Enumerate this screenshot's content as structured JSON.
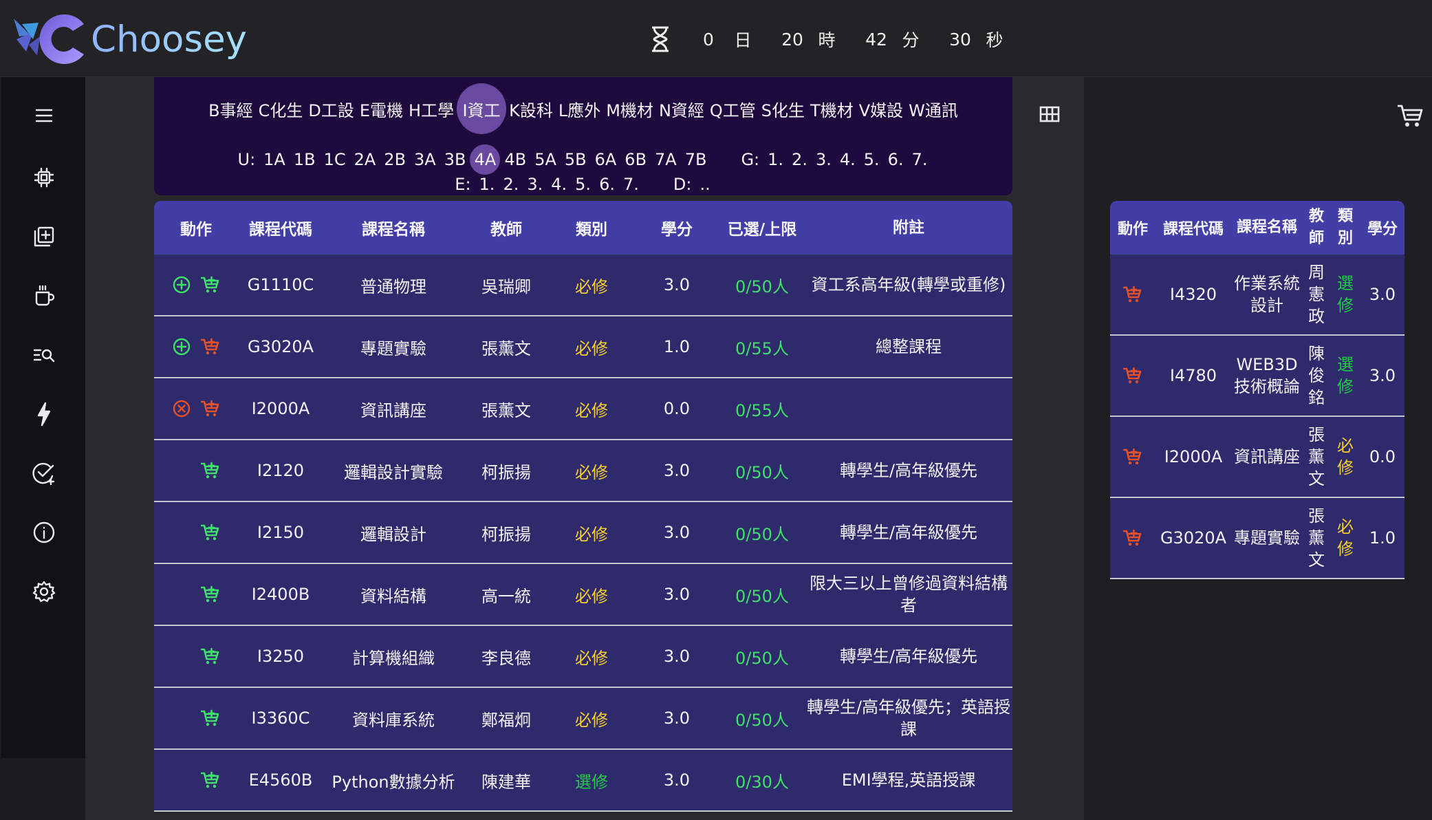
{
  "app": {
    "name": "Choosey"
  },
  "timer": {
    "days": "0",
    "days_unit": "日",
    "hours": "20",
    "hours_unit": "時",
    "minutes": "42",
    "minutes_unit": "分",
    "seconds": "30",
    "seconds_unit": "秒"
  },
  "sidebar": {
    "items": [
      {
        "icon": "menu-icon"
      },
      {
        "icon": "chip-icon"
      },
      {
        "icon": "add-box-icon"
      },
      {
        "icon": "coffee-icon"
      },
      {
        "icon": "search-list-icon"
      },
      {
        "icon": "flash-icon"
      },
      {
        "icon": "check-add-icon"
      },
      {
        "icon": "info-icon"
      },
      {
        "icon": "settings-icon"
      }
    ]
  },
  "departments": [
    "B事經",
    "C化生",
    "D工設",
    "E電機",
    "H工學",
    "I資工",
    "K設科",
    "L應外",
    "M機材",
    "N資經",
    "Q工管",
    "S化生",
    "T機材",
    "V媒設",
    "W通訊"
  ],
  "selected_department": "I資工",
  "grade_filter": {
    "u_label": "U:",
    "u_items": [
      "1A",
      "1B",
      "1C",
      "2A",
      "2B",
      "3A",
      "3B",
      "4A",
      "4B",
      "5A",
      "5B",
      "6A",
      "6B",
      "7A",
      "7B"
    ],
    "u_selected": "4A",
    "g_label": "G:",
    "g_items": [
      "1.",
      "2.",
      "3.",
      "4.",
      "5.",
      "6.",
      "7."
    ],
    "e_label": "E:",
    "e_items": [
      "1.",
      "2.",
      "3.",
      "4.",
      "5.",
      "6.",
      "7."
    ],
    "d_label": "D:",
    "d_items": [
      ".."
    ]
  },
  "course_table": {
    "headers": [
      "動作",
      "課程代碼",
      "課程名稱",
      "教師",
      "類別",
      "學分",
      "已選/上限",
      "附註"
    ],
    "rows": [
      {
        "add": "add",
        "cart": "green",
        "code": "G1110C",
        "name": "普通物理",
        "teacher": "吳瑞卿",
        "type": "必修",
        "type_kind": "req",
        "credit": "3.0",
        "enrolled": "0/50人",
        "note": "資工系高年級(轉學或重修)"
      },
      {
        "add": "add",
        "cart": "red",
        "code": "G3020A",
        "name": "專題實驗",
        "teacher": "張薰文",
        "type": "必修",
        "type_kind": "req",
        "credit": "1.0",
        "enrolled": "0/55人",
        "note": "總整課程"
      },
      {
        "add": "remove",
        "cart": "red",
        "code": "I2000A",
        "name": "資訊講座",
        "teacher": "張薰文",
        "type": "必修",
        "type_kind": "req",
        "credit": "0.0",
        "enrolled": "0/55人",
        "note": ""
      },
      {
        "add": "",
        "cart": "green",
        "code": "I2120",
        "name": "邏輯設計實驗",
        "teacher": "柯振揚",
        "type": "必修",
        "type_kind": "req",
        "credit": "3.0",
        "enrolled": "0/50人",
        "note": "轉學生/高年級優先"
      },
      {
        "add": "",
        "cart": "green",
        "code": "I2150",
        "name": "邏輯設計",
        "teacher": "柯振揚",
        "type": "必修",
        "type_kind": "req",
        "credit": "3.0",
        "enrolled": "0/50人",
        "note": "轉學生/高年級優先"
      },
      {
        "add": "",
        "cart": "green",
        "code": "I2400B",
        "name": "資料結構",
        "teacher": "高一統",
        "type": "必修",
        "type_kind": "req",
        "credit": "3.0",
        "enrolled": "0/50人",
        "note": "限大三以上曾修過資料結構者"
      },
      {
        "add": "",
        "cart": "green",
        "code": "I3250",
        "name": "計算機組織",
        "teacher": "李良德",
        "type": "必修",
        "type_kind": "req",
        "credit": "3.0",
        "enrolled": "0/50人",
        "note": "轉學生/高年級優先"
      },
      {
        "add": "",
        "cart": "green",
        "code": "I3360C",
        "name": "資料庫系統",
        "teacher": "鄭福炯",
        "type": "必修",
        "type_kind": "req",
        "credit": "3.0",
        "enrolled": "0/50人",
        "note": "轉學生/高年級優先；英語授課"
      },
      {
        "add": "",
        "cart": "green",
        "code": "E4560B",
        "name": "Python數據分析",
        "teacher": "陳建華",
        "type": "選修",
        "type_kind": "ele",
        "credit": "3.0",
        "enrolled": "0/30人",
        "note": "EMI學程,英語授課"
      }
    ]
  },
  "cart_table": {
    "headers": [
      "動作",
      "課程代碼",
      "課程名稱",
      "教師",
      "類別",
      "學分"
    ],
    "rows": [
      {
        "code": "I4320",
        "name": "作業系統設計",
        "teacher": "周憲政",
        "type": "選修",
        "type_kind": "ele",
        "credit": "3.0"
      },
      {
        "code": "I4780",
        "name": "WEB3D技術概論",
        "teacher": "陳俊銘",
        "type": "選修",
        "type_kind": "ele",
        "credit": "3.0"
      },
      {
        "code": "I2000A",
        "name": "資訊講座",
        "teacher": "張薰文",
        "type": "必修",
        "type_kind": "req",
        "credit": "0.0"
      },
      {
        "code": "G3020A",
        "name": "專題實驗",
        "teacher": "張薰文",
        "type": "必修",
        "type_kind": "req",
        "credit": "1.0"
      }
    ]
  },
  "colors": {
    "header_bg": "#433da6",
    "row_bg": "#2f2a6b",
    "dept_bg": "#1e0a3c",
    "selected": "#6a4aa0",
    "required": "#f4cf2e",
    "elective": "#22c94a",
    "cart_red": "#e4502a",
    "cart_green": "#3ee06a"
  }
}
